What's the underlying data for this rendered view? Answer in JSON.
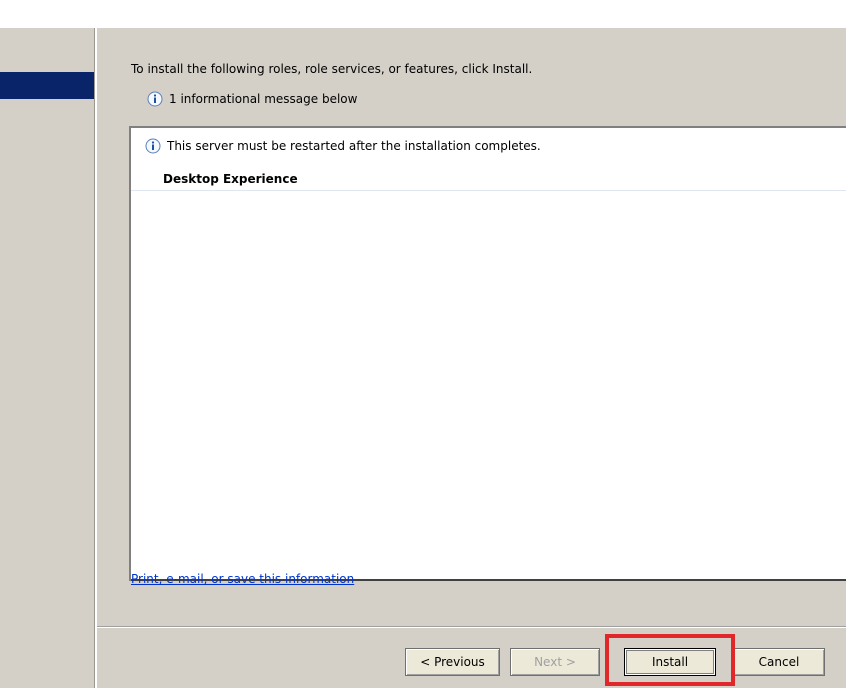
{
  "content": {
    "instruction": "To install the following roles, role services, or features, click Install.",
    "info_summary": "1 informational message below",
    "info_icon": "info-icon"
  },
  "results": {
    "restart_message": "This server must be restarted after the installation completes.",
    "feature": "Desktop Experience"
  },
  "links": {
    "print_save": "Print, e-mail, or save this information"
  },
  "buttons": {
    "previous": "< Previous",
    "next": "Next >",
    "install": "Install",
    "cancel": "Cancel"
  },
  "colors": {
    "nav_selected": "#0a246a",
    "highlight": "#e0282a",
    "link": "#0033cc"
  }
}
